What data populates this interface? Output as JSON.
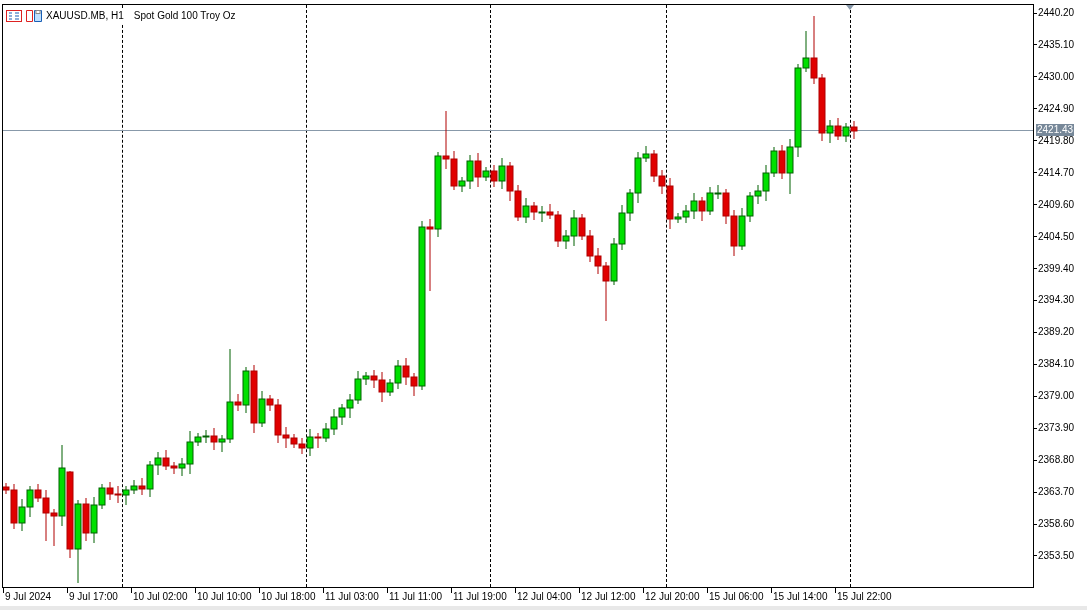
{
  "header": {
    "symbol": "XAUUSD.MB, H1",
    "description": "Spot Gold 100 Troy Oz"
  },
  "price_axis": {
    "ticks": [
      "2440.20",
      "2435.10",
      "2430.00",
      "2424.90",
      "2419.80",
      "2414.70",
      "2409.60",
      "2404.50",
      "2399.40",
      "2394.30",
      "2389.20",
      "2384.10",
      "2379.00",
      "2373.90",
      "2368.80",
      "2363.70",
      "2358.60",
      "2353.50"
    ],
    "current_price": "2421.43"
  },
  "time_axis": {
    "labels": [
      "9 Jul 2024",
      "9 Jul 17:00",
      "10 Jul 02:00",
      "10 Jul 10:00",
      "10 Jul 18:00",
      "11 Jul 03:00",
      "11 Jul 11:00",
      "11 Jul 19:00",
      "12 Jul 04:00",
      "12 Jul 12:00",
      "12 Jul 20:00",
      "15 Jul 06:00",
      "15 Jul 14:00",
      "15 Jul 22:00"
    ]
  }
}
